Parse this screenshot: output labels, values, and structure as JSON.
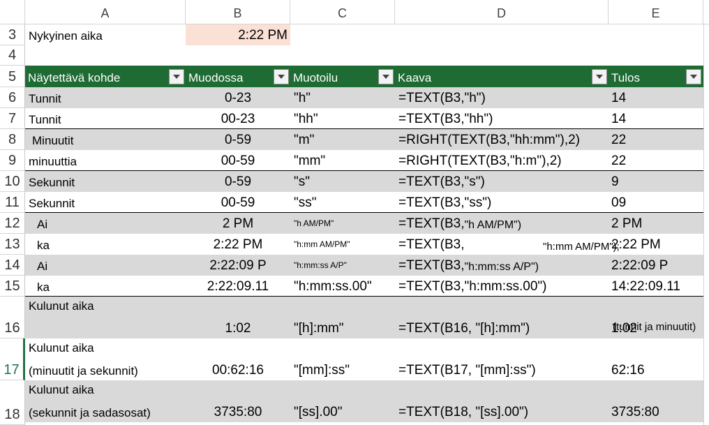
{
  "columns": [
    "A",
    "B",
    "C",
    "D",
    "E"
  ],
  "row3": {
    "num": "3",
    "label": "Nykyinen aika",
    "value": "2:22 PM"
  },
  "row4": {
    "num": "4"
  },
  "row5": {
    "num": "5"
  },
  "header": {
    "a": "Näytettävä kohde",
    "b": "Muodossa",
    "c": "Muotoilu",
    "d": "Kaava",
    "e": "Tulos"
  },
  "rows": [
    {
      "num": "6",
      "a": "Tunnit",
      "b": "0-23",
      "c": "\"h\"",
      "d": "=TEXT(B3,\"h\")",
      "e": "14"
    },
    {
      "num": "7",
      "a": "Tunnit",
      "b": "00-23",
      "c": "\"hh\"",
      "d": "=TEXT(B3,\"hh\")",
      "e": "14"
    },
    {
      "num": "8",
      "a": "Minuutit",
      "b": "0-59",
      "c": "\"m\"",
      "d": "=RIGHT(TEXT(B3,\"hh:mm\"),2)",
      "e": "22"
    },
    {
      "num": "9",
      "a": "minuuttia",
      "b": "00-59",
      "c": "\"mm\"",
      "d": "=RIGHT(TEXT(B3,\"h:m\"),2)",
      "e": "22"
    },
    {
      "num": "10",
      "a": "Sekunnit",
      "b": "0-59",
      "c": "\"s\"",
      "d": "=TEXT(B3,\"s\")",
      "e": "9"
    },
    {
      "num": "11",
      "a": "Sekunnit",
      "b": "00-59",
      "c": "\"ss\"",
      "d": "=TEXT(B3,\"ss\")",
      "e": "09"
    },
    {
      "num": "12",
      "a": "Ai",
      "b": "2 PM",
      "c": "\"h AM/PM\"",
      "d1": "=TEXT(B3,",
      "d2": "\"h AM/PM\")",
      "e": "2 PM"
    },
    {
      "num": "13",
      "a": "ka",
      "b": "2:22 PM",
      "c": "\"h:mm AM/PM\"",
      "d1": "=TEXT(B3,",
      "d2": "\"h:mm AM/PM\");",
      "e": "2:22 PM"
    },
    {
      "num": "14",
      "a": "Ai",
      "b": "2:22:09 P",
      "c": "\"h:mm:ss A/P\"",
      "d1": "=TEXT(B3,",
      "d2": "\"h:mm:ss A/P\")",
      "e": "2:22:09 P"
    },
    {
      "num": "15",
      "a": "ka",
      "b": "2:22:09.11",
      "c": "\"h:mm:ss.00\"",
      "d": "=TEXT(B3,\"h:mm:ss.00\")",
      "e": "14:22:09.11"
    }
  ],
  "row16": {
    "num": "16",
    "a1": "Kulunut aika",
    "b": "1:02",
    "c": "\"[h]:mm\"",
    "d": "=TEXT(B16, \"[h]:mm\")",
    "e": "1:02",
    "e_note": "(tunnit ja minuutit)"
  },
  "row17": {
    "num": "17",
    "a1": "Kulunut aika",
    "a2": "(minuutit ja sekunnit)",
    "b": "00:62:16",
    "c": "\"[mm]:ss\"",
    "d": "=TEXT(B17, \"[mm]:ss\")",
    "e": "62:16"
  },
  "row18": {
    "num": "18",
    "a1": "Kulunut aika",
    "a2": "(sekunnit ja sadasosat)",
    "b": "3735:80",
    "c": "\"[ss].00\"",
    "d": "=TEXT(B18, \"[ss].00\")",
    "e": "3735:80"
  },
  "colors": {
    "header_bg": "#1e6b34",
    "band": "#d9d9d9",
    "highlight": "#fbe0d5",
    "selected_row": "#217346"
  }
}
